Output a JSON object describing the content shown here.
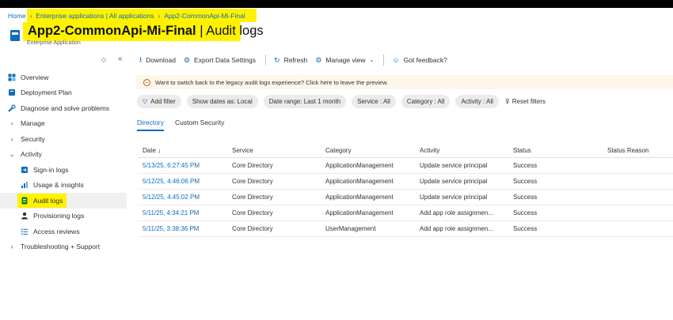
{
  "breadcrumb": {
    "home": "Home",
    "items": [
      "Enterprise applications | All applications",
      "App2-CommonApi-Mi-Final"
    ]
  },
  "header": {
    "app_name": "App2-CommonApi-Mi-Final",
    "separator": " | ",
    "page_name": "Audit logs",
    "more": "···",
    "subtitle": "Enterprise Application"
  },
  "sidebar": {
    "items": [
      {
        "label": "Overview",
        "icon": "overview-icon"
      },
      {
        "label": "Deployment Plan",
        "icon": "book-icon"
      },
      {
        "label": "Diagnose and solve problems",
        "icon": "wrench-icon"
      },
      {
        "label": "Manage",
        "icon": "chevron-right-icon"
      },
      {
        "label": "Security",
        "icon": "chevron-right-icon"
      },
      {
        "label": "Activity",
        "icon": "chevron-down-icon"
      },
      {
        "label": "Sign-in logs",
        "icon": "sign-in-icon"
      },
      {
        "label": "Usage & insights",
        "icon": "chart-icon"
      },
      {
        "label": "Audit logs",
        "icon": "audit-log-icon"
      },
      {
        "label": "Provisioning logs",
        "icon": "person-icon"
      },
      {
        "label": "Access reviews",
        "icon": "list-icon"
      },
      {
        "label": "Troubleshooting + Support",
        "icon": "chevron-right-icon"
      }
    ]
  },
  "toolbar": {
    "download": "Download",
    "export": "Export Data Settings",
    "refresh": "Refresh",
    "manage_view": "Manage view",
    "feedback": "Got feedback?"
  },
  "banner": {
    "text": "Want to switch back to the legacy audit logs experience? Click here to leave the preview."
  },
  "filters": {
    "add_filter": "Add filter",
    "show_dates": "Show dates as: Local",
    "date_range": "Date range: Last 1 month",
    "service": "Service : All",
    "category": "Category : All",
    "activity": "Activity : All",
    "reset": "Reset filters"
  },
  "tabs": [
    "Directory",
    "Custom Security"
  ],
  "table": {
    "columns": [
      "Date ↓",
      "Service",
      "Category",
      "Activity",
      "Status",
      "Status Reason"
    ],
    "rows": [
      [
        "5/13/25, 6:27:45 PM",
        "Core Directory",
        "ApplicationManagement",
        "Update service principal",
        "Success",
        ""
      ],
      [
        "5/12/25, 4:46:06 PM",
        "Core Directory",
        "ApplicationManagement",
        "Update service principal",
        "Success",
        ""
      ],
      [
        "5/12/25, 4:45:02 PM",
        "Core Directory",
        "ApplicationManagement",
        "Update service principal",
        "Success",
        ""
      ],
      [
        "5/11/25, 4:34:21 PM",
        "Core Directory",
        "ApplicationManagement",
        "Add app role assignmen...",
        "Success",
        ""
      ],
      [
        "5/11/25, 3:38:36 PM",
        "Core Directory",
        "UserManagement",
        "Add app role assignmen...",
        "Success",
        ""
      ]
    ]
  },
  "colors": {
    "accent": "#0f6cbd",
    "highlight": "#fff200",
    "banner_bg": "#fdf6e9",
    "warning": "#c4590f"
  }
}
